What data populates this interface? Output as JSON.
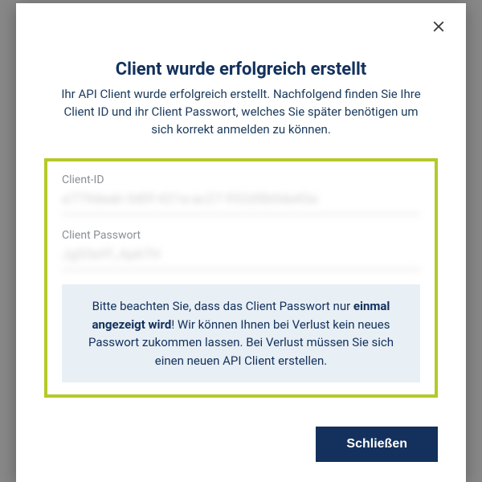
{
  "modal": {
    "title": "Client wurde erfolgreich erstellt",
    "description": "Ihr API Client wurde erfolgreich erstellt. Nachfolgend finden Sie Ihre Client ID und ihr Client Passwort, welches Sie später benötigen um sich korrekt anmelden zu können.",
    "fields": {
      "client_id": {
        "label": "Client-ID",
        "value": "a779deab-3d0f-421a-ac27-932d5b0da43a"
      },
      "client_password": {
        "label": "Client Passwort",
        "value": "Jg53aYf_Ap67H"
      }
    },
    "notice": {
      "prefix": "Bitte beachten Sie, dass das Client Passwort nur ",
      "bold": "einmal angezeigt wird",
      "suffix": "! Wir können Ihnen bei Verlust kein neues Passwort zukommen lassen. Bei Verlust müssen Sie sich einen neuen API Client erstellen."
    },
    "close_button": "Schließen"
  }
}
